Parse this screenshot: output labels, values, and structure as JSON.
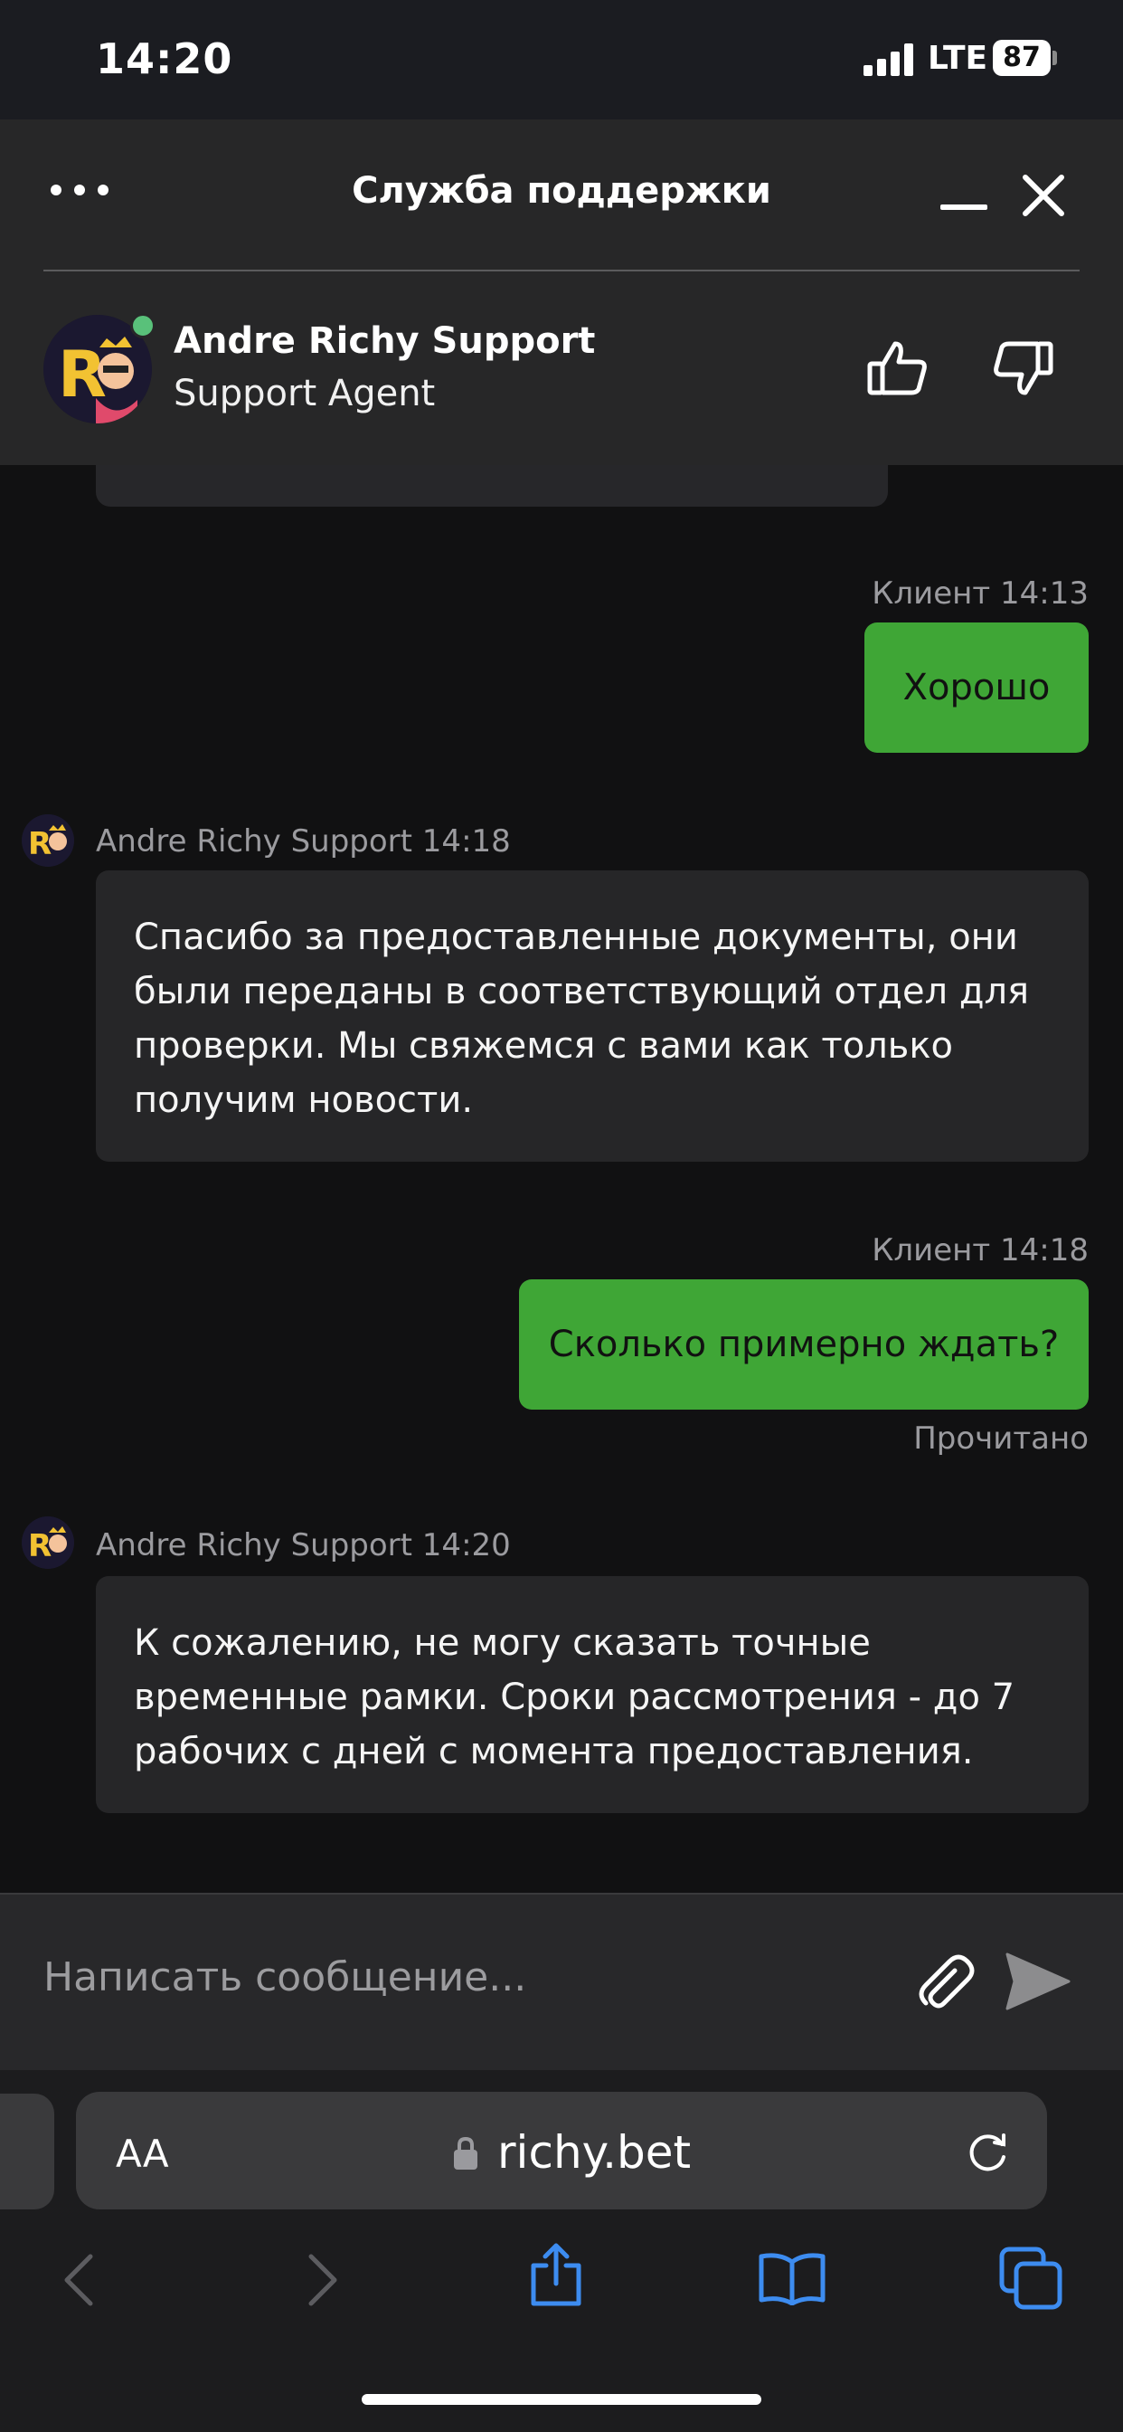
{
  "status_bar": {
    "time": "14:20",
    "network": "LTE",
    "battery": "87"
  },
  "header": {
    "title": "Служба поддержки",
    "agent_name": "Andre Richy Support",
    "agent_role": "Support Agent",
    "icons": [
      "more-dots-icon",
      "minimize-icon",
      "close-icon",
      "thumbs-up-icon",
      "thumbs-down-icon"
    ]
  },
  "messages": [
    {
      "from": "client",
      "meta": "Клиент 14:13",
      "text": "Хорошо"
    },
    {
      "from": "agent",
      "meta": "Andre Richy Support 14:18",
      "text": "Спасибо за предоставленные документы, они были переданы в соответствующий отдел для проверки. Мы свяжемся с вами как только получим новости."
    },
    {
      "from": "client",
      "meta": "Клиент 14:18",
      "text": "Сколько примерно ждать?",
      "receipt": "Прочитано"
    },
    {
      "from": "agent",
      "meta": "Andre Richy Support 14:20",
      "text": "К сожалению, не могу сказать точные временные рамки. Сроки рассмотрения - до 7 рабочих с дней с момента предоставления."
    }
  ],
  "composer": {
    "placeholder": "Написать сообщение..."
  },
  "browser": {
    "aa_label": "AA",
    "url": "richy.bet"
  },
  "colors": {
    "accent": "#3fa636",
    "online": "#59c17a",
    "header_bg": "#272728",
    "chat_bg": "#111112"
  }
}
